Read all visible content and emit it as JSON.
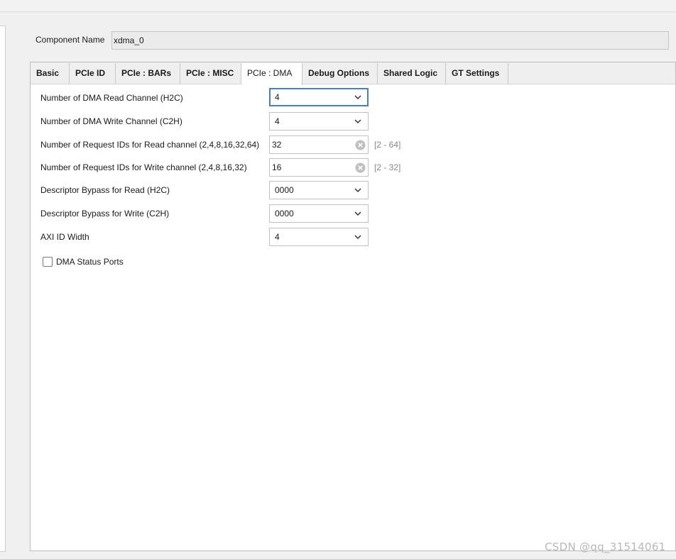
{
  "component": {
    "label": "Component Name",
    "value": "xdma_0"
  },
  "tabs": [
    {
      "label": "Basic",
      "active": false
    },
    {
      "label": "PCIe ID",
      "active": false
    },
    {
      "label": "PCIe : BARs",
      "active": false
    },
    {
      "label": "PCIe : MISC",
      "active": false
    },
    {
      "label": "PCIe : DMA",
      "active": true
    },
    {
      "label": "Debug Options",
      "active": false
    },
    {
      "label": "Shared Logic",
      "active": false
    },
    {
      "label": "GT Settings",
      "active": false
    }
  ],
  "settings": {
    "read_channels": {
      "label": "Number of DMA Read Channel (H2C)",
      "value": "4"
    },
    "write_channels": {
      "label": "Number of DMA Write Channel (C2H)",
      "value": "4"
    },
    "read_request_ids": {
      "label": "Number of Request IDs for Read channel (2,4,8,16,32,64)",
      "value": "32",
      "range": "[2 - 64]"
    },
    "write_request_ids": {
      "label": "Number of Request IDs for Write channel (2,4,8,16,32)",
      "value": "16",
      "range": "[2 - 32]"
    },
    "bypass_read": {
      "label": "Descriptor Bypass for Read (H2C)",
      "value": "0000"
    },
    "bypass_write": {
      "label": "Descriptor Bypass for Write (C2H)",
      "value": "0000"
    },
    "axi_id_width": {
      "label": "AXI ID Width",
      "value": "4"
    }
  },
  "dma_status_ports": {
    "label": "DMA Status Ports",
    "checked": false
  },
  "watermark": "CSDN @qq_31514061",
  "colors": {
    "focus_border": "#4a7ec2",
    "range_text": "#888888"
  }
}
